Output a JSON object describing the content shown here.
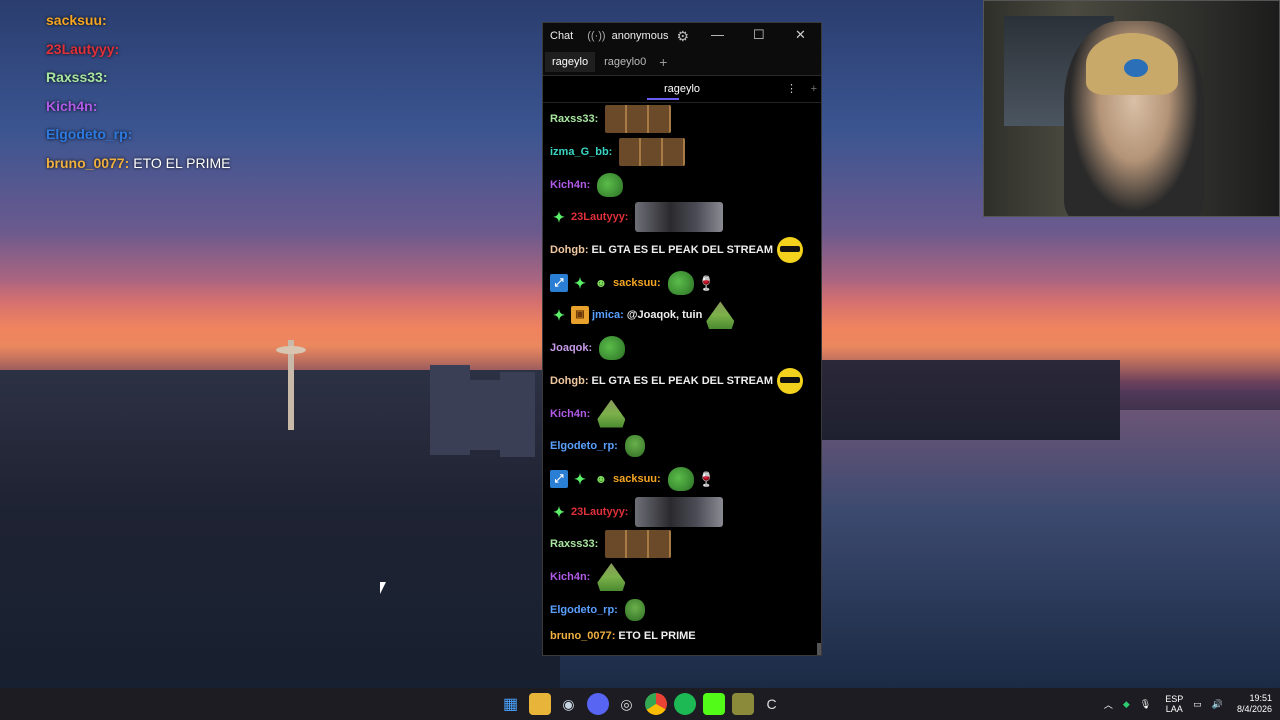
{
  "overlay_chat": [
    {
      "user": "sacksuu",
      "suffix": ":",
      "color": "#f5a623",
      "text": ""
    },
    {
      "user": "23Lautyyy",
      "suffix": ":",
      "color": "#e0303a",
      "text": ""
    },
    {
      "user": "Raxss33",
      "suffix": ":",
      "color": "#a8e6a0",
      "text": ""
    },
    {
      "user": "Kich4n",
      "suffix": ":",
      "color": "#b05ae8",
      "text": ""
    },
    {
      "user": "Elgodeto_rp",
      "suffix": ":",
      "color": "#2d7be0",
      "text": ""
    },
    {
      "user": "bruno_0077",
      "suffix": ":",
      "color": "#f0b040",
      "text": "ETO EL PRIME"
    }
  ],
  "chat_window": {
    "title": "Chat",
    "user": "anonymous",
    "tabs": [
      "rageylo",
      "rageylo0"
    ],
    "channel": "rageylo"
  },
  "messages": [
    {
      "user": "Raxss33:",
      "color": "#a8e6a0",
      "text": "",
      "badges": [],
      "emote": "three"
    },
    {
      "user": "izma_G_bb:",
      "color": "#3ad6c4",
      "text": "",
      "badges": [],
      "emote": "three"
    },
    {
      "user": "Kich4n:",
      "color": "#b05ae8",
      "text": "",
      "badges": [],
      "emote": "pepe"
    },
    {
      "user": "23Lautyyy:",
      "color": "#e0303a",
      "text": "",
      "badges": [
        "star"
      ],
      "emote": "photo"
    },
    {
      "user": "Dohgb:",
      "color": "#f0c8a0",
      "text": "EL GTA ES EL PEAK DEL STREAM",
      "badges": [],
      "emote": "cool"
    },
    {
      "user": "sacksuu:",
      "color": "#f5a623",
      "text": "",
      "badges": [
        "blue",
        "star",
        "bot"
      ],
      "emote": "pepe"
    },
    {
      "user": "jmica:",
      "color": "#5aa0ff",
      "text": "@Joaqok, tuin",
      "badges": [
        "star",
        "box"
      ],
      "emote": "hat"
    },
    {
      "user": "Joaqok:",
      "color": "#c79be8",
      "text": "",
      "badges": [],
      "emote": "pepe"
    },
    {
      "user": "Dohgb:",
      "color": "#f0c8a0",
      "text": "EL GTA ES EL PEAK DEL STREAM",
      "badges": [],
      "emote": "cool"
    },
    {
      "user": "Kich4n:",
      "color": "#b05ae8",
      "text": "",
      "badges": [],
      "emote": "hat"
    },
    {
      "user": "Elgodeto_rp:",
      "color": "#5aa0ff",
      "text": "",
      "badges": [],
      "emote": "small"
    },
    {
      "user": "sacksuu:",
      "color": "#f5a623",
      "text": "",
      "badges": [
        "blue",
        "star",
        "bot"
      ],
      "emote": "pepe"
    },
    {
      "user": "23Lautyyy:",
      "color": "#e0303a",
      "text": "",
      "badges": [
        "star"
      ],
      "emote": "photo"
    },
    {
      "user": "Raxss33:",
      "color": "#a8e6a0",
      "text": "",
      "badges": [],
      "emote": "three"
    },
    {
      "user": "Kich4n:",
      "color": "#b05ae8",
      "text": "",
      "badges": [],
      "emote": "hat"
    },
    {
      "user": "Elgodeto_rp:",
      "color": "#5aa0ff",
      "text": "",
      "badges": [],
      "emote": "small"
    },
    {
      "user": "bruno_0077:",
      "color": "#f0b040",
      "text": "ETO EL PRIME",
      "badges": [],
      "emote": ""
    }
  ],
  "taskbar": {
    "apps": [
      "start-icon",
      "file-explorer-icon",
      "steam-icon",
      "discord-icon",
      "chatterino-icon",
      "chrome-icon",
      "spotify-icon",
      "kick-icon",
      "emote-app-icon",
      "ccleaner-icon"
    ],
    "lang_top": "ESP",
    "lang_bottom": "LAA",
    "time": "19:51",
    "date": "8/4/2026"
  }
}
